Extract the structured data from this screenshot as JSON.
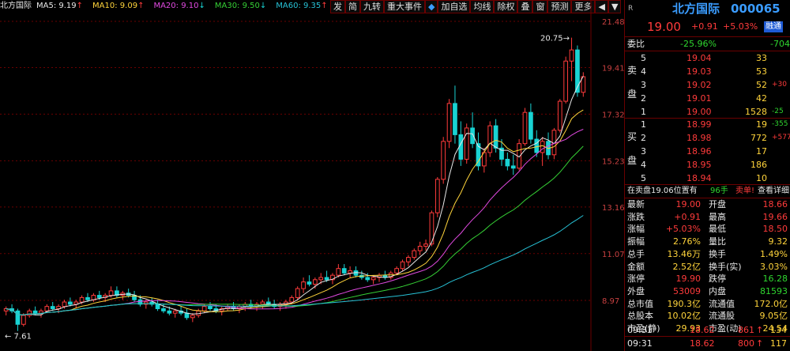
{
  "stock": {
    "name": "北方国际",
    "code": "000065",
    "price": "19.00",
    "change": "+0.91",
    "pct": "+5.03%",
    "badge": "融通",
    "corner": "R"
  },
  "ma": [
    {
      "label": "北方国际",
      "value": "",
      "arrow": "",
      "color": "#e8e8e8"
    },
    {
      "label": "MA5:",
      "value": "9.19",
      "arrow": "↑",
      "color": "#e8e8e8"
    },
    {
      "label": "MA10:",
      "value": "9.09",
      "arrow": "↑",
      "color": "#ffd43b"
    },
    {
      "label": "MA20:",
      "value": "9.10",
      "arrow": "↓",
      "color": "#e14ae1"
    },
    {
      "label": "MA30:",
      "value": "9.50",
      "arrow": "↓",
      "color": "#35d035"
    },
    {
      "label": "MA60:",
      "value": "9.35",
      "arrow": "↑",
      "color": "#27c2d6"
    }
  ],
  "toolbar": [
    "发",
    "简",
    "九转",
    "重大事件",
    "◆",
    "加自选",
    "均线",
    "除权",
    "叠",
    "窗",
    "预测",
    "更多",
    "◀",
    "▼"
  ],
  "axis_labels": [
    "21.48",
    "19.41",
    "17.32",
    "15.23",
    "13.16",
    "11.07",
    "8.97"
  ],
  "annotations": {
    "high": "20.75",
    "low": "7.61"
  },
  "chart_data": {
    "type": "candlestick",
    "ylim": [
      7.2,
      21.8
    ],
    "yticks": [
      21.48,
      19.41,
      17.32,
      15.23,
      13.16,
      11.07,
      8.97
    ],
    "ohlc": [
      [
        8.5,
        8.7,
        8.3,
        8.6
      ],
      [
        8.6,
        8.8,
        8.4,
        8.5
      ],
      [
        8.5,
        8.6,
        7.6,
        7.9
      ],
      [
        7.9,
        8.4,
        7.8,
        8.3
      ],
      [
        8.3,
        8.6,
        8.2,
        8.5
      ],
      [
        8.5,
        8.7,
        8.3,
        8.4
      ],
      [
        8.4,
        8.6,
        8.2,
        8.5
      ],
      [
        8.5,
        8.8,
        8.4,
        8.7
      ],
      [
        8.7,
        8.9,
        8.5,
        8.6
      ],
      [
        8.6,
        8.8,
        8.4,
        8.7
      ],
      [
        8.7,
        9.0,
        8.6,
        8.9
      ],
      [
        8.9,
        9.1,
        8.7,
        8.8
      ],
      [
        8.8,
        9.0,
        8.6,
        8.9
      ],
      [
        8.9,
        9.2,
        8.8,
        9.1
      ],
      [
        9.1,
        9.3,
        8.9,
        9.0
      ],
      [
        9.0,
        9.3,
        8.9,
        9.2
      ],
      [
        9.2,
        9.4,
        9.0,
        9.1
      ],
      [
        9.1,
        9.3,
        8.9,
        9.2
      ],
      [
        9.2,
        9.6,
        9.1,
        9.4
      ],
      [
        9.4,
        9.6,
        9.1,
        9.2
      ],
      [
        9.2,
        9.4,
        9.0,
        9.3
      ],
      [
        9.3,
        9.5,
        9.1,
        9.2
      ],
      [
        9.2,
        9.4,
        8.9,
        9.0
      ],
      [
        9.0,
        9.2,
        8.7,
        8.8
      ],
      [
        8.8,
        9.0,
        8.6,
        8.9
      ],
      [
        8.9,
        9.1,
        8.7,
        8.8
      ],
      [
        8.8,
        9.0,
        8.5,
        8.6
      ],
      [
        8.6,
        8.8,
        8.4,
        8.5
      ],
      [
        8.5,
        8.7,
        8.3,
        8.4
      ],
      [
        8.4,
        8.6,
        8.2,
        8.5
      ],
      [
        8.5,
        8.7,
        8.3,
        8.4
      ],
      [
        8.4,
        8.6,
        8.1,
        8.2
      ],
      [
        8.2,
        8.4,
        8.0,
        8.3
      ],
      [
        8.3,
        8.6,
        8.2,
        8.5
      ],
      [
        8.5,
        8.8,
        8.4,
        8.7
      ],
      [
        8.7,
        8.9,
        8.5,
        8.6
      ],
      [
        8.6,
        8.8,
        8.4,
        8.5
      ],
      [
        8.5,
        8.7,
        8.3,
        8.6
      ],
      [
        8.6,
        8.8,
        8.5,
        8.7
      ],
      [
        8.7,
        8.9,
        8.5,
        8.6
      ],
      [
        8.6,
        8.8,
        8.4,
        8.7
      ],
      [
        8.7,
        8.9,
        8.5,
        8.8
      ],
      [
        8.8,
        9.0,
        8.6,
        8.7
      ],
      [
        8.7,
        8.9,
        8.5,
        8.8
      ],
      [
        8.8,
        9.0,
        8.6,
        8.9
      ],
      [
        8.9,
        9.1,
        8.7,
        8.8
      ],
      [
        8.8,
        9.0,
        8.6,
        8.7
      ],
      [
        8.7,
        8.9,
        8.5,
        8.8
      ],
      [
        8.8,
        9.0,
        8.6,
        8.9
      ],
      [
        8.9,
        9.2,
        8.8,
        9.1
      ],
      [
        9.1,
        9.6,
        9.0,
        9.5
      ],
      [
        9.5,
        10.0,
        9.3,
        9.8
      ],
      [
        9.8,
        10.1,
        9.6,
        9.7
      ],
      [
        9.7,
        10.0,
        9.5,
        9.9
      ],
      [
        9.9,
        10.2,
        9.7,
        10.0
      ],
      [
        10.0,
        10.3,
        9.8,
        9.9
      ],
      [
        9.9,
        10.2,
        9.7,
        10.1
      ],
      [
        10.1,
        10.6,
        10.0,
        10.4
      ],
      [
        10.4,
        10.6,
        10.1,
        10.2
      ],
      [
        10.2,
        10.5,
        10.0,
        10.3
      ],
      [
        10.3,
        10.5,
        10.0,
        10.1
      ],
      [
        10.1,
        10.3,
        9.9,
        10.0
      ],
      [
        10.0,
        10.2,
        9.8,
        9.9
      ],
      [
        9.9,
        10.1,
        9.7,
        10.0
      ],
      [
        10.0,
        10.2,
        9.8,
        10.1
      ],
      [
        10.1,
        10.3,
        9.9,
        10.0
      ],
      [
        10.0,
        10.3,
        9.9,
        10.2
      ],
      [
        10.2,
        10.5,
        10.1,
        10.4
      ],
      [
        10.4,
        10.8,
        10.3,
        10.7
      ],
      [
        10.7,
        11.0,
        10.5,
        10.9
      ],
      [
        10.9,
        11.3,
        10.8,
        11.2
      ],
      [
        11.2,
        11.6,
        11.0,
        11.4
      ],
      [
        11.4,
        11.7,
        11.2,
        11.5
      ],
      [
        11.5,
        13.0,
        11.4,
        12.9
      ],
      [
        12.9,
        14.5,
        12.7,
        14.4
      ],
      [
        14.4,
        16.3,
        14.2,
        16.1
      ],
      [
        16.1,
        18.0,
        15.8,
        17.8
      ],
      [
        17.8,
        18.6,
        16.0,
        16.4
      ],
      [
        16.4,
        17.0,
        15.0,
        15.3
      ],
      [
        15.3,
        16.9,
        15.1,
        16.7
      ],
      [
        16.7,
        17.4,
        15.8,
        16.0
      ],
      [
        16.0,
        16.5,
        14.8,
        15.0
      ],
      [
        15.0,
        15.8,
        14.7,
        15.6
      ],
      [
        15.6,
        17.0,
        15.4,
        16.8
      ],
      [
        16.8,
        17.1,
        15.6,
        15.8
      ],
      [
        15.8,
        16.2,
        15.0,
        15.3
      ],
      [
        15.3,
        15.6,
        14.8,
        15.0
      ],
      [
        15.0,
        15.5,
        14.6,
        14.9
      ],
      [
        14.9,
        16.2,
        14.8,
        16.0
      ],
      [
        16.0,
        17.6,
        15.9,
        17.4
      ],
      [
        17.4,
        17.8,
        16.0,
        16.2
      ],
      [
        16.2,
        16.6,
        15.4,
        15.6
      ],
      [
        15.6,
        16.3,
        15.0,
        16.1
      ],
      [
        16.1,
        16.5,
        15.3,
        15.5
      ],
      [
        15.5,
        16.7,
        15.3,
        16.6
      ],
      [
        16.6,
        18.0,
        16.5,
        17.9
      ],
      [
        17.9,
        19.9,
        17.8,
        19.7
      ],
      [
        19.7,
        20.75,
        18.8,
        20.2
      ],
      [
        20.2,
        20.4,
        18.1,
        18.3
      ],
      [
        18.3,
        19.2,
        18.1,
        19.0
      ]
    ],
    "ma5": [],
    "ma10": [],
    "ma20": [],
    "ma30": [],
    "ma60": []
  },
  "quote": {
    "weibi": {
      "label": "委比",
      "pct": "-25.96%",
      "diff": "-704"
    },
    "sell": [
      {
        "n": "5",
        "p": "19.04",
        "v": "33",
        "d": ""
      },
      {
        "n": "4",
        "p": "19.03",
        "v": "53",
        "d": ""
      },
      {
        "n": "3",
        "p": "19.02",
        "v": "52",
        "d": "+30"
      },
      {
        "n": "2",
        "p": "19.01",
        "v": "42",
        "d": ""
      },
      {
        "n": "1",
        "p": "19.00",
        "v": "1528",
        "d": "-25"
      }
    ],
    "sell_side": [
      "卖",
      "盘"
    ],
    "buy": [
      {
        "n": "1",
        "p": "18.99",
        "v": "19",
        "d": "-355"
      },
      {
        "n": "2",
        "p": "18.98",
        "v": "772",
        "d": "+577"
      },
      {
        "n": "3",
        "p": "18.96",
        "v": "17",
        "d": ""
      },
      {
        "n": "4",
        "p": "18.95",
        "v": "186",
        "d": ""
      },
      {
        "n": "5",
        "p": "18.94",
        "v": "10",
        "d": ""
      }
    ],
    "buy_side": [
      "买",
      "盘"
    ],
    "notice": {
      "text": "在卖盘19.06位置有",
      "count": "96手",
      "action": "卖单!",
      "link": "查看详细"
    },
    "stats": [
      {
        "l1": "最新",
        "v1": "19.00",
        "c1": "red",
        "l2": "开盘",
        "v2": "18.66",
        "c2": "red"
      },
      {
        "l1": "涨跌",
        "v1": "+0.91",
        "c1": "red",
        "l2": "最高",
        "v2": "19.66",
        "c2": "red"
      },
      {
        "l1": "涨幅",
        "v1": "+5.03%",
        "c1": "red",
        "l2": "最低",
        "v2": "18.50",
        "c2": "red"
      },
      {
        "l1": "振幅",
        "v1": "2.76%",
        "c1": "yellow",
        "l2": "量比",
        "v2": "9.32",
        "c2": "yellow"
      },
      {
        "l1": "总手",
        "v1": "13.46万",
        "c1": "yellow",
        "l2": "换手",
        "v2": "1.49%",
        "c2": "yellow"
      },
      {
        "l1": "金额",
        "v1": "2.52亿",
        "c1": "yellow",
        "l2": "换手(实)",
        "v2": "3.03%",
        "c2": "yellow"
      },
      {
        "l1": "涨停",
        "v1": "19.90",
        "c1": "red",
        "l2": "跌停",
        "v2": "16.28",
        "c2": "green"
      },
      {
        "l1": "外盘",
        "v1": "53009",
        "c1": "red",
        "l2": "内盘",
        "v2": "81593",
        "c2": "green"
      },
      {
        "l1": "总市值",
        "v1": "190.3亿",
        "c1": "yellow",
        "l2": "流通值",
        "v2": "172.0亿",
        "c2": "yellow"
      },
      {
        "l1": "总股本",
        "v1": "10.02亿",
        "c1": "yellow",
        "l2": "流通股",
        "v2": "9.05亿",
        "c2": "yellow"
      },
      {
        "l1": "市盈(静)",
        "v1": "29.93",
        "c1": "yellow",
        "l2": "市盈(动)",
        "v2": "24.54",
        "c2": "yellow"
      }
    ],
    "ticks": [
      {
        "t": "09:31",
        "p": "18.62",
        "v": "861",
        "a": "↑",
        "n": "134"
      },
      {
        "t": "09:31",
        "p": "18.62",
        "v": "800",
        "a": "↑",
        "n": "117"
      }
    ]
  },
  "colors": {
    "up": "#ff3b3b",
    "down": "#19d3d3",
    "grid": "#6b0000",
    "ma5": "#e8e8e8",
    "ma10": "#ffd43b",
    "ma20": "#e14ae1",
    "ma30": "#35d035",
    "ma60": "#27c2d6"
  }
}
